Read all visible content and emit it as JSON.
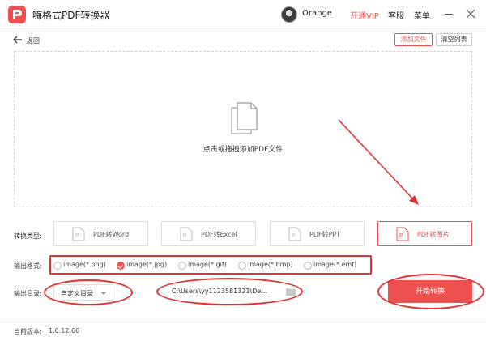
{
  "app": {
    "title": "嗨格式PDF转换器"
  },
  "header": {
    "username": "Orange",
    "vip_label": "开通VIP",
    "service_label": "客服",
    "menu_label": "菜单"
  },
  "toolbar": {
    "back_label": "返回",
    "add_file_label": "添加文件",
    "clear_list_label": "清空列表"
  },
  "dropzone": {
    "hint": "点击或拖拽添加PDF文件"
  },
  "conversion": {
    "label": "转换类型:",
    "types": [
      {
        "label": "PDF转Word",
        "active": false
      },
      {
        "label": "PDF转Excel",
        "active": false
      },
      {
        "label": "PDF转PPT",
        "active": false
      },
      {
        "label": "PDF转图片",
        "active": true
      }
    ]
  },
  "output_format": {
    "label": "输出格式:",
    "options": [
      {
        "label": "image(*.png)",
        "checked": false
      },
      {
        "label": "image(*.jpg)",
        "checked": true
      },
      {
        "label": "image(*.gif)",
        "checked": false
      },
      {
        "label": "image(*.bmp)",
        "checked": false
      },
      {
        "label": "image(*.emf)",
        "checked": false
      }
    ]
  },
  "output_dir": {
    "label": "输出目录:",
    "selected": "自定义目录",
    "path": "C:\\Users\\yy1123581321\\De..."
  },
  "actions": {
    "start_label": "开始转换"
  },
  "footer": {
    "version_label": "当前版本:",
    "version": "1.0.12.66"
  },
  "colors": {
    "accent": "#ee4f4f",
    "annotation": "#e53030"
  },
  "icons": [
    "app-logo-icon",
    "back-arrow-icon",
    "document-stack-icon",
    "pdf-file-icon",
    "folder-icon",
    "minimize-icon",
    "close-icon"
  ]
}
